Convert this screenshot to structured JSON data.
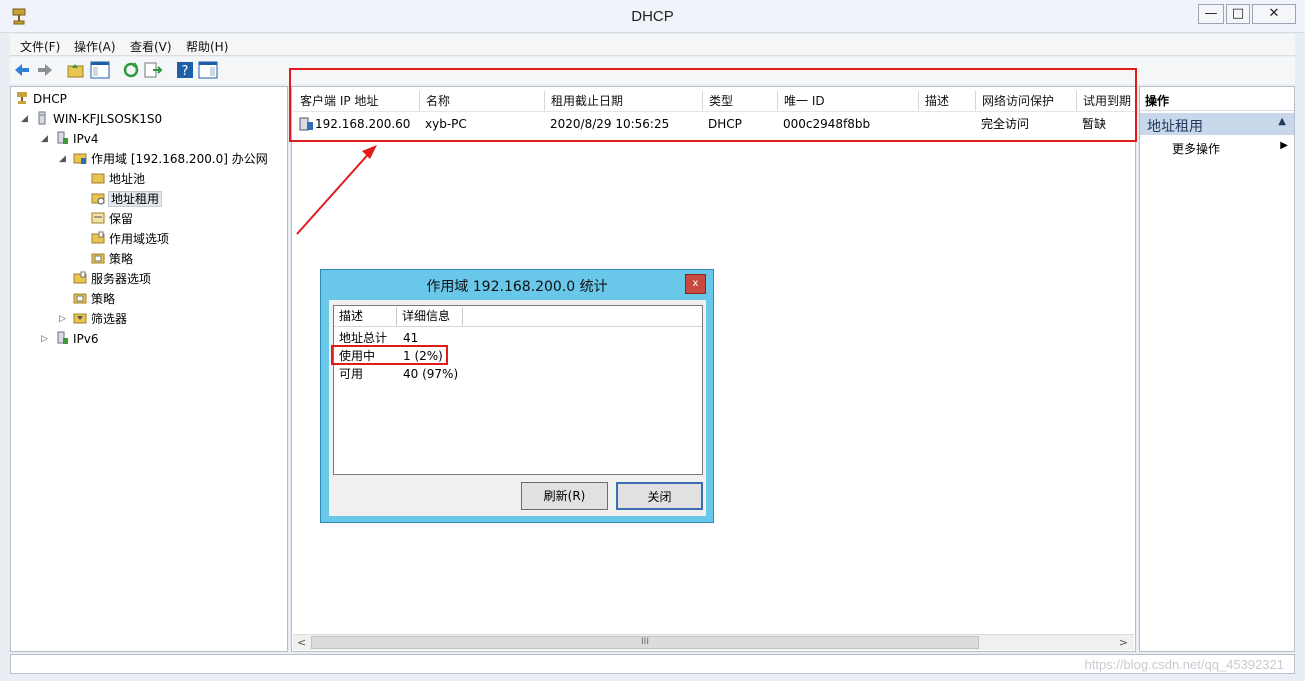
{
  "window": {
    "title": "DHCP",
    "minimize": "—",
    "maximize": "□",
    "close": "✕"
  },
  "menu": [
    "文件(F)",
    "操作(A)",
    "查看(V)",
    "帮助(H)"
  ],
  "tree": {
    "root": "DHCP",
    "server": "WIN-KFJLSOSK1S0",
    "ipv4": "IPv4",
    "scope": "作用域 [192.168.200.0] 办公网",
    "address_pool": "地址池",
    "address_leases": "地址租用",
    "reservations": "保留",
    "scope_options": "作用域选项",
    "scope_policies": "策略",
    "server_options": "服务器选项",
    "policies": "策略",
    "filters": "筛选器",
    "ipv6": "IPv6"
  },
  "list": {
    "columns": [
      "客户端 IP 地址",
      "名称",
      "租用截止日期",
      "类型",
      "唯一 ID",
      "描述",
      "网络访问保护",
      "试用到期"
    ],
    "rows": [
      {
        "ip": "192.168.200.60",
        "name": "xyb-PC",
        "expires": "2020/8/29 10:56:25",
        "type": "DHCP",
        "uid": "000c2948f8bb",
        "desc": "",
        "nap": "完全访问",
        "probation": "暂缺"
      }
    ],
    "scroll_left": "<",
    "scroll_mid": "III",
    "scroll_right": ">"
  },
  "actions": {
    "header": "操作",
    "section": "地址租用",
    "more": "更多操作"
  },
  "dialog": {
    "title": "作用域 192.168.200.0 统计",
    "close": "x",
    "columns": [
      "描述",
      "详细信息"
    ],
    "rows": [
      {
        "label": "地址总计",
        "value": "41"
      },
      {
        "label": "使用中",
        "value": "1 (2%)"
      },
      {
        "label": "可用",
        "value": "40 (97%)"
      }
    ],
    "refresh": "刷新(R)",
    "close_btn": "关闭"
  },
  "watermark": "https://blog.csdn.net/qq_45392321",
  "colors": {
    "annotation": "#e11a1a",
    "dialog_frame": "#69c7ea"
  }
}
